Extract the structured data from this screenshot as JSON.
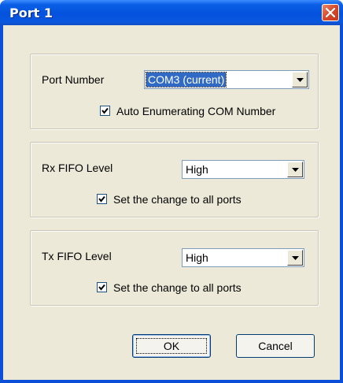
{
  "window": {
    "title": "Port 1"
  },
  "port_group": {
    "label": "Port Number",
    "selected": "COM3 (current)",
    "checkbox_label": "Auto Enumerating COM Number",
    "checked": true
  },
  "rx_group": {
    "label": "Rx FIFO Level",
    "selected": "High",
    "checkbox_label": "Set the change to all ports",
    "checked": true
  },
  "tx_group": {
    "label": "Tx FIFO Level",
    "selected": "High",
    "checkbox_label": "Set the change to all ports",
    "checked": true
  },
  "buttons": {
    "ok": "OK",
    "cancel": "Cancel"
  },
  "colors": {
    "titlebar": "#0452dd",
    "dialog_bg": "#ece9d8",
    "selection": "#316ac5"
  }
}
